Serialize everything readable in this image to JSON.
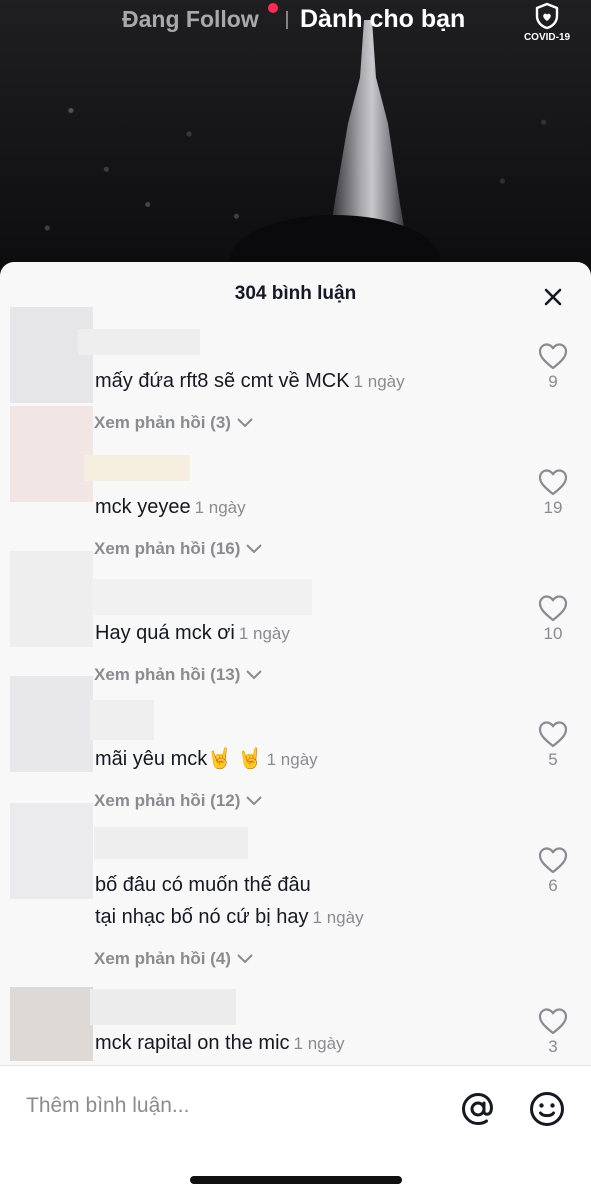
{
  "header": {
    "following_label": "Đang Follow",
    "for_you_label": "Dành cho bạn",
    "covid_label": "COVID-19",
    "covid_icon": "shield-heart-icon"
  },
  "comments_panel": {
    "title": "304 bình luận",
    "close_icon": "close-icon",
    "comments": [
      {
        "text": "mấy đứa rft8 sẽ cmt về MCK",
        "time": "1 ngày",
        "replies": "Xem phản hồi (3)",
        "likes": "9"
      },
      {
        "text": "mck yeyee",
        "time": "1 ngày",
        "replies": "Xem phản hồi (16)",
        "likes": "19"
      },
      {
        "text": "Hay quá mck ơi",
        "time": "1 ngày",
        "replies": "Xem phản hồi (13)",
        "likes": "10"
      },
      {
        "text": "mãi yêu mck🤘 🤘",
        "time": "1 ngày",
        "replies": "Xem phản hồi (12)",
        "likes": "5"
      },
      {
        "text_line1": "bố đâu có muốn thế đâu",
        "text": "tại nhạc bố nó cứ bị hay",
        "time": "1 ngày",
        "replies": "Xem phản hồi (4)",
        "likes": "6"
      },
      {
        "text": "mck rapital on the mic",
        "time": "1 ngày",
        "likes": "3"
      }
    ]
  },
  "input_bar": {
    "placeholder": "Thêm bình luận...",
    "mention_icon": "at-sign-icon",
    "emoji_icon": "emoji-icon"
  },
  "colors": {
    "accent": "#fe2c55",
    "text_primary": "#161823",
    "text_secondary": "#8a8b91",
    "sheet_bg": "#f8f8f8"
  }
}
